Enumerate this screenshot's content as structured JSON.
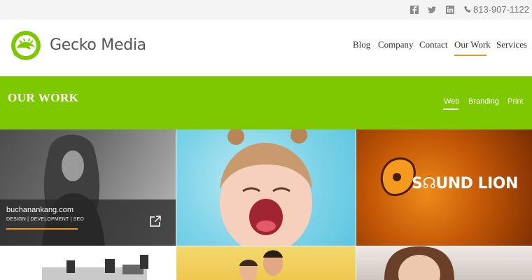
{
  "topbar": {
    "icons": [
      "facebook-icon",
      "twitter-icon",
      "linkedin-icon"
    ],
    "phone": "813-907-1122"
  },
  "brand": {
    "name": "Gecko Media",
    "color": "#7ec800"
  },
  "nav": {
    "items": [
      "Blog",
      "Company",
      "Contact",
      "Our Work",
      "Services"
    ],
    "active": "Our Work",
    "accent": "#d9a026"
  },
  "banner": {
    "title": "OUR WORK",
    "filters": [
      "Web",
      "Branding",
      "Print"
    ],
    "active_filter": "Web"
  },
  "portfolio": {
    "featured": {
      "title": "buchanankang.com",
      "subtitle": "DESIGN | DEVELOPMENT | SEO"
    },
    "logo_text": "S☊UND LION"
  }
}
